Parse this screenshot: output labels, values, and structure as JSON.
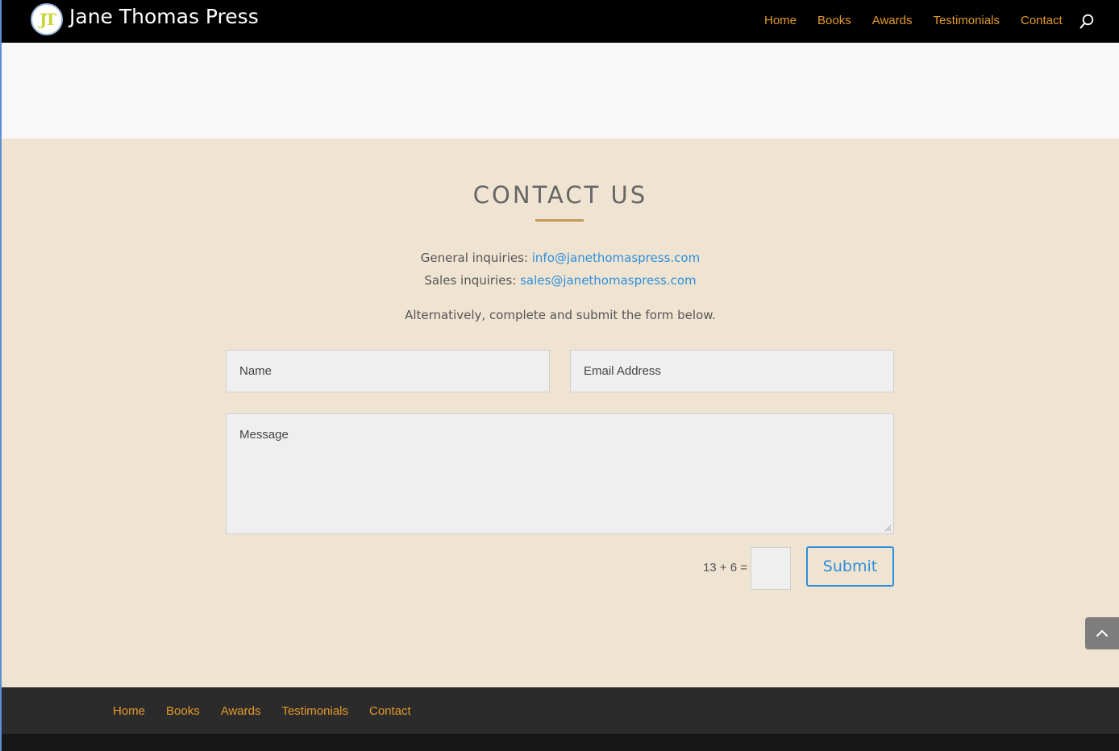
{
  "header": {
    "site_title": "Jane Thomas Press",
    "logo_letters": "JT",
    "nav": [
      "Home",
      "Books",
      "Awards",
      "Testimonials",
      "Contact"
    ]
  },
  "contact": {
    "title": "CONTACT US",
    "general_label": "General inquiries: ",
    "general_email": "info@janethomaspress.com",
    "sales_label": "Sales inquiries: ",
    "sales_email": "sales@janethomaspress.com",
    "alt_text": "Alternatively, complete and submit the form below.",
    "form": {
      "name_placeholder": "Name",
      "email_placeholder": "Email Address",
      "message_placeholder": "Message",
      "captcha": "13 + 6 =",
      "submit_label": "Submit"
    }
  },
  "footer": {
    "nav": [
      "Home",
      "Books",
      "Awards",
      "Testimonials",
      "Contact"
    ]
  },
  "colors": {
    "header_bg": "#000000",
    "nav_link": "#e49a2a",
    "contact_bg": "#efe4d1",
    "link_blue": "#2e8fdc",
    "footer_bg": "#2b2b2b"
  },
  "icons": {
    "search": "search-icon",
    "back_to_top": "chevron-up-icon"
  }
}
